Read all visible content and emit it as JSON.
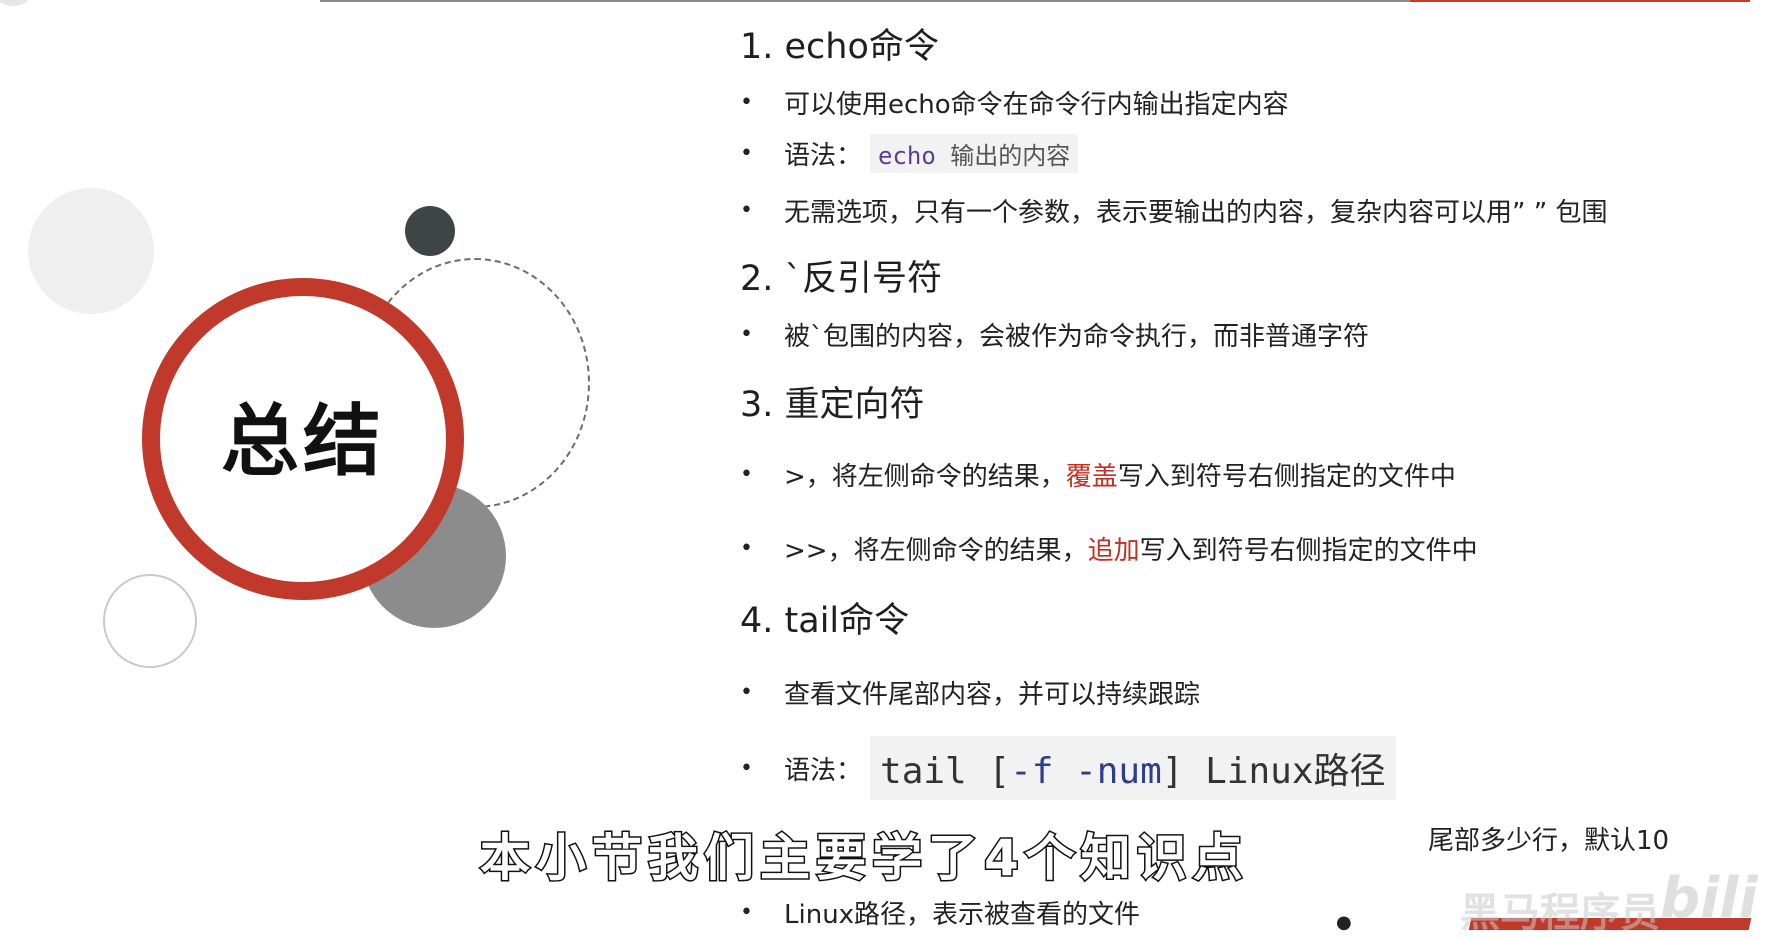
{
  "summary": {
    "title": "总结"
  },
  "bullet_symbol": "•",
  "sections": {
    "echo": {
      "heading": "1. echo命令",
      "items": {
        "desc": "可以使用echo命令在命令行内输出指定内容",
        "syntax_label": "语法：",
        "syntax_keyword": "echo",
        "syntax_rest": " 输出的内容",
        "note": "无需选项，只有一个参数，表示要输出的内容，复杂内容可以用” ” 包围"
      }
    },
    "backtick": {
      "heading": "2. `反引号符",
      "items": {
        "desc": "被`包围的内容，会被作为命令执行，而非普通字符"
      }
    },
    "redirect": {
      "heading": "3. 重定向符",
      "items": {
        "overwrite_pre": ">，将左侧命令的结果，",
        "overwrite_hl": "覆盖",
        "overwrite_post": "写入到符号右侧指定的文件中",
        "append_pre": ">>，将左侧命令的结果，",
        "append_hl": "追加",
        "append_post": "写入到符号右侧指定的文件中"
      }
    },
    "tail": {
      "heading": "4. tail命令",
      "items": {
        "desc": "查看文件尾部内容，并可以持续跟踪",
        "syntax_label": "语法：",
        "syntax_cmd": "tail [",
        "syntax_opt": "-f -num",
        "syntax_close": "] Linux路径",
        "num_note": "尾部多少行，默认10",
        "path_note": "Linux路径，表示被查看的文件"
      }
    }
  },
  "subtitle": "本小节我们主要学了4个知识点",
  "watermark": {
    "text": "黑马程序员",
    "logo": "bili"
  },
  "colors": {
    "accent_red": "#c0392b",
    "highlight_red": "#c62d1f",
    "dark": "#3f4447"
  }
}
